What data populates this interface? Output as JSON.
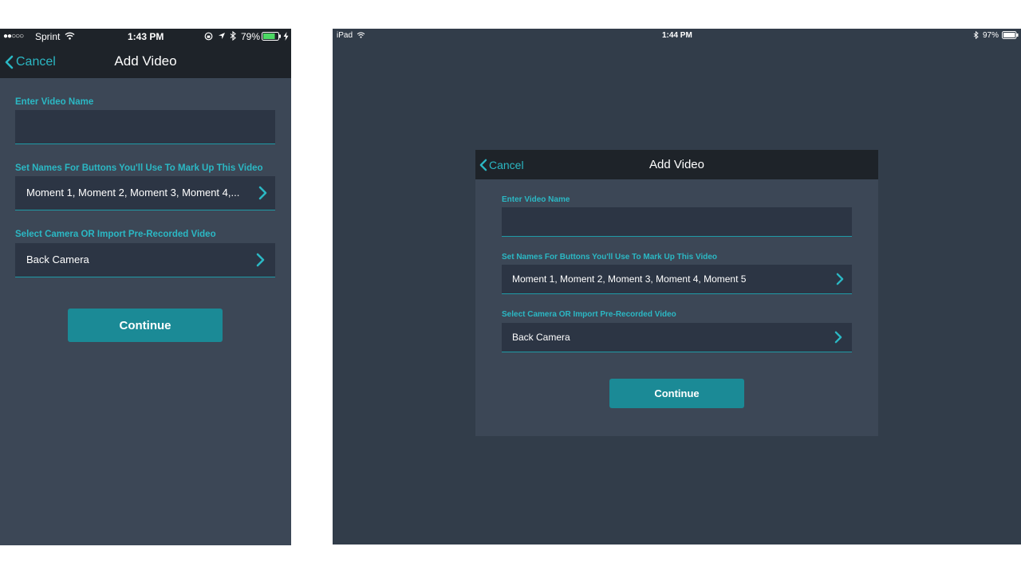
{
  "phone": {
    "status": {
      "signal": "●●○○○",
      "carrier": "Sprint",
      "time": "1:43 PM",
      "battery": "79%"
    },
    "nav": {
      "back_label": "Cancel",
      "title": "Add Video"
    },
    "form": {
      "video_name_label": "Enter Video Name",
      "video_name_value": "",
      "buttons_label": "Set Names For Buttons You'll Use To Mark Up This Video",
      "buttons_value": "Moment 1, Moment 2, Moment 3, Moment 4,...",
      "source_label": "Select Camera OR Import Pre-Recorded Video",
      "source_value": "Back Camera",
      "continue_label": "Continue"
    }
  },
  "tablet": {
    "status": {
      "device": "iPad",
      "time": "1:44 PM",
      "battery": "97%"
    },
    "nav": {
      "back_label": "Cancel",
      "title": "Add Video"
    },
    "form": {
      "video_name_label": "Enter Video Name",
      "video_name_value": "",
      "buttons_label": "Set Names For Buttons You'll Use To Mark Up This Video",
      "buttons_value": "Moment 1, Moment 2, Moment 3, Moment 4, Moment 5",
      "source_label": "Select Camera OR Import Pre-Recorded Video",
      "source_value": "Back Camera",
      "continue_label": "Continue"
    }
  },
  "colors": {
    "accent": "#2bb8c4",
    "button": "#1b8a96",
    "navbar": "#1e2329",
    "panel": "#3c4756",
    "field": "#2c3544",
    "backdrop": "#323d4a"
  }
}
